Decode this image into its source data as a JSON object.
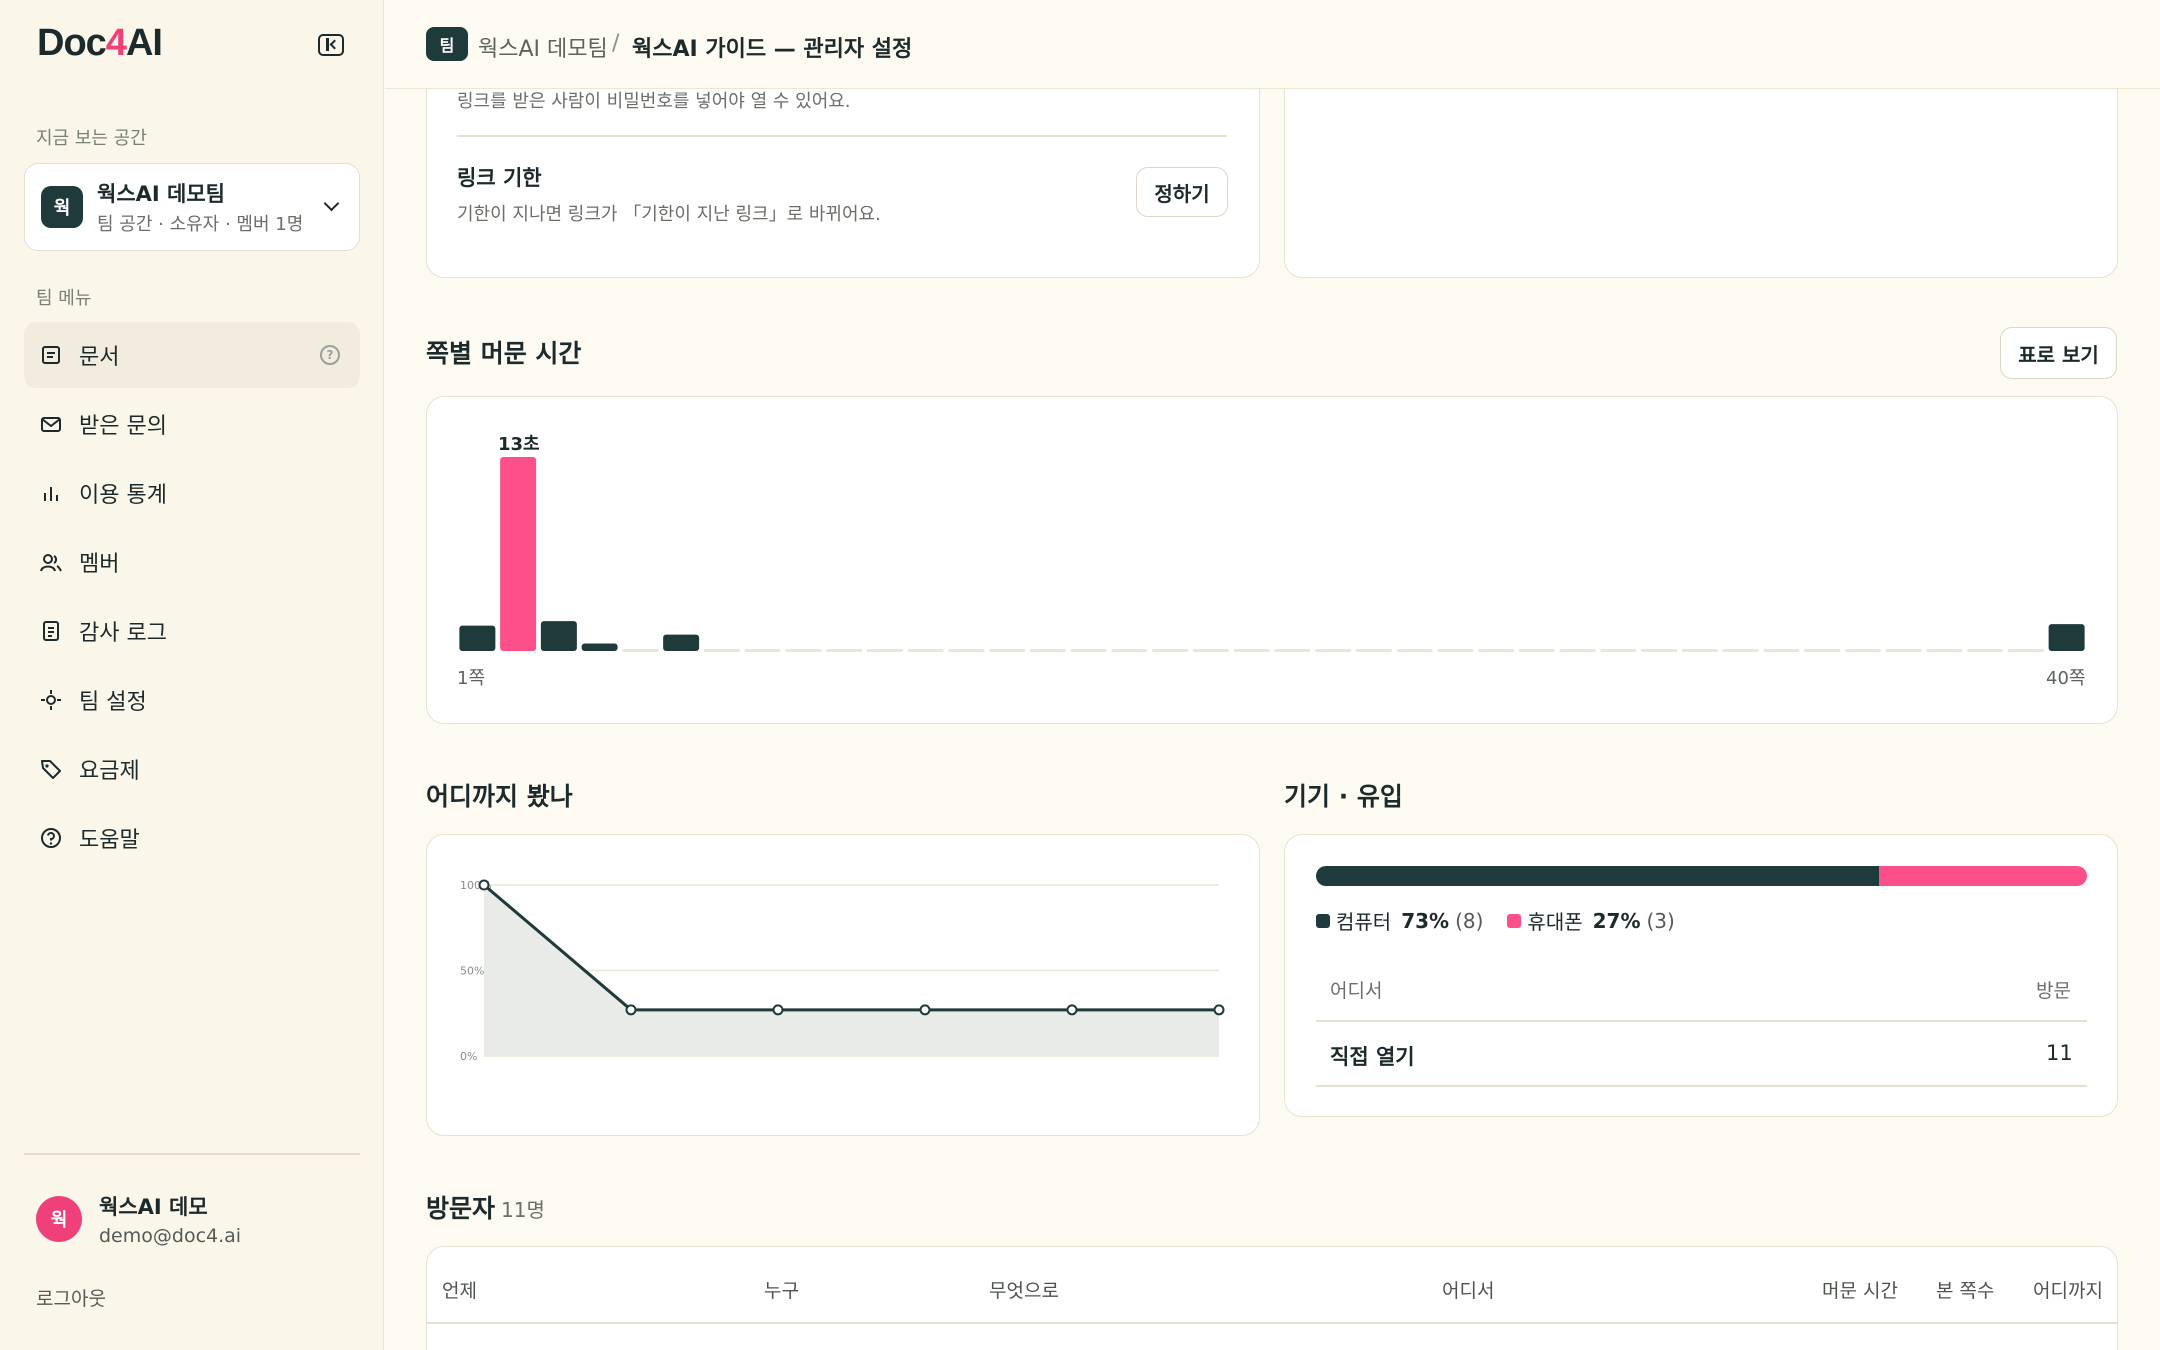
{
  "sidebar": {
    "logo_prefix": "Doc",
    "logo_accent": "4",
    "logo_suffix": "AI",
    "space_label": "지금 보는 공간",
    "workspace": {
      "avatar": "웍",
      "name": "웍스AI 데모팀",
      "meta": "팀 공간 · 소유자 · 멤버 1명"
    },
    "menu_label": "팀 메뉴",
    "items": [
      {
        "label": "문서",
        "icon": "document-icon",
        "active": true
      },
      {
        "label": "받은 문의",
        "icon": "mail-icon"
      },
      {
        "label": "이용 통계",
        "icon": "bar-chart-icon"
      },
      {
        "label": "멤버",
        "icon": "members-icon"
      },
      {
        "label": "감사 로그",
        "icon": "audit-log-icon"
      },
      {
        "label": "팀 설정",
        "icon": "settings-icon"
      },
      {
        "label": "요금제",
        "icon": "tag-icon"
      },
      {
        "label": "도움말",
        "icon": "help-icon"
      }
    ],
    "user": {
      "avatar": "웍",
      "name": "웍스AI 데모",
      "email": "demo@doc4.ai"
    },
    "logout": "로그아웃"
  },
  "header": {
    "badge": "팀",
    "team": "웍스AI 데모팀",
    "separator": "/",
    "page": "웍스AI 가이드 — 관리자 설정"
  },
  "settings": {
    "password_desc": "링크를 받은 사람이 비밀번호를 넣어야 열 수 있어요.",
    "expiry_title": "링크 기한",
    "expiry_desc": "기한이 지나면 링크가 「기한이 지난 링크」로 바뀌어요.",
    "expiry_button": "정하기"
  },
  "page_time": {
    "title": "쪽별 머문 시간",
    "table_button": "표로 보기",
    "peak_label": "13초",
    "first_label": "1쪽",
    "last_label": "40쪽"
  },
  "reach": {
    "title": "어디까지 봤나"
  },
  "device": {
    "title": "기기 · 유입",
    "computer_label": "컴퓨터",
    "computer_pct": "73%",
    "computer_count": "(8)",
    "mobile_label": "휴대폰",
    "mobile_pct": "27%",
    "mobile_count": "(3)",
    "computer_share": 0.73,
    "ref_head_source": "어디서",
    "ref_head_visits": "방문",
    "ref_rows": [
      {
        "source": "직접 열기",
        "visits": "11"
      }
    ]
  },
  "visitors": {
    "title": "방문자",
    "count": "11명",
    "columns": [
      "언제",
      "누구",
      "무엇으로",
      "어디서",
      "머문 시간",
      "본 쪽수",
      "어디까지"
    ]
  },
  "colors": {
    "dark": "#1f3a3a",
    "pink": "#fd4f8a",
    "bg": "#fdfaf1"
  },
  "chart_data": [
    {
      "type": "bar",
      "title": "쪽별 머문 시간",
      "x_first": "1쪽",
      "x_last": "40쪽",
      "categories": [
        "1",
        "2",
        "3",
        "4",
        "5",
        "6",
        "7",
        "8",
        "9",
        "10",
        "11",
        "12",
        "13",
        "14",
        "15",
        "16",
        "17",
        "18",
        "19",
        "20",
        "21",
        "22",
        "23",
        "24",
        "25",
        "26",
        "27",
        "28",
        "29",
        "30",
        "31",
        "32",
        "33",
        "34",
        "35",
        "36",
        "37",
        "38",
        "39",
        "40"
      ],
      "values": [
        1.7,
        13,
        2,
        0.5,
        0,
        1.1,
        0,
        0,
        0,
        0,
        0,
        0,
        0,
        0,
        0,
        0,
        0,
        0,
        0,
        0,
        0,
        0,
        0,
        0,
        0,
        0,
        0,
        0,
        0,
        0,
        0,
        0,
        0,
        0,
        0,
        0,
        0,
        0,
        0,
        1.8
      ],
      "highlight_index": 1,
      "unit": "초"
    },
    {
      "type": "area",
      "title": "어디까지 봤나",
      "x": [
        1,
        2,
        3,
        4,
        5,
        6
      ],
      "y": [
        100,
        27,
        27,
        27,
        27,
        27
      ],
      "y_ticks": [
        "100%",
        "50%",
        "0%"
      ],
      "ylim": [
        0,
        100
      ]
    }
  ]
}
